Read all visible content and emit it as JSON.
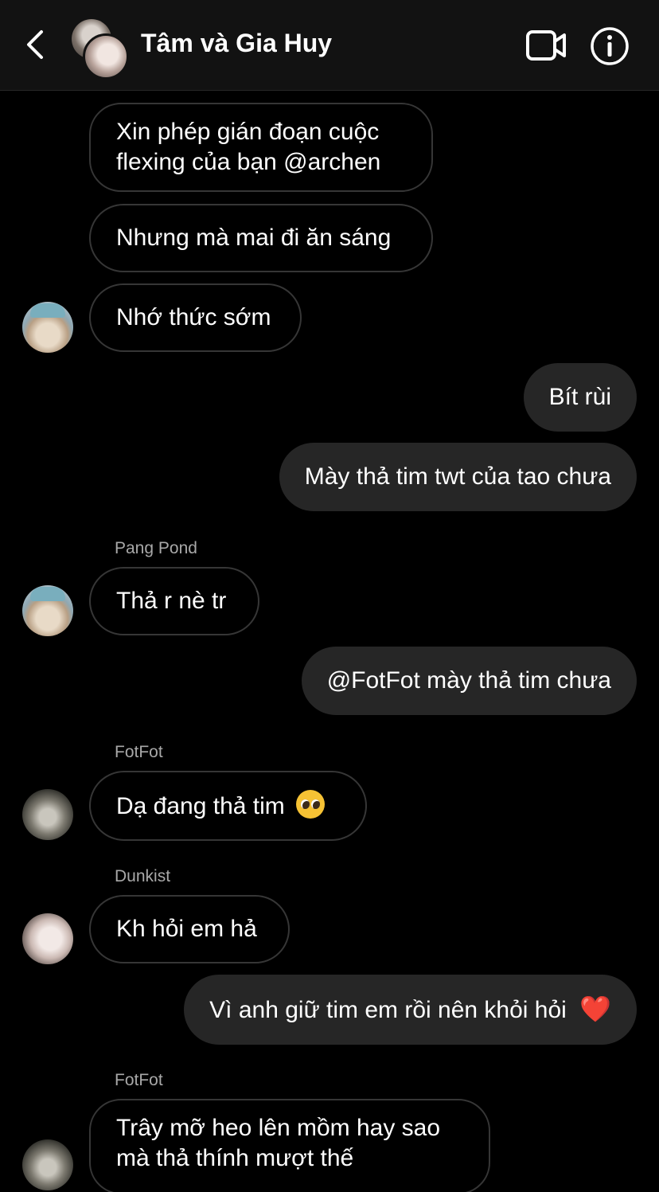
{
  "header": {
    "title": "Tâm và Gia Huy",
    "back_icon": "chevron-left-icon",
    "video_icon": "video-camera-icon",
    "info_icon": "info-icon"
  },
  "messages": [
    {
      "direction": "in",
      "text_line1": "Xin phép gián đoạn cuộc",
      "text_line2": "flexing của bạn @archen"
    },
    {
      "direction": "in",
      "text": "Nhưng mà mai đi ăn sáng"
    },
    {
      "direction": "in",
      "text": "Nhớ thức sớm"
    },
    {
      "direction": "out",
      "text": "Bít rùi"
    },
    {
      "direction": "out",
      "text": "Mày thả tim twt của tao chưa"
    },
    {
      "direction": "in",
      "sender": "Pang Pond",
      "text": "Thả r nè tr"
    },
    {
      "direction": "out",
      "text": "@FotFot mày thả tim chưa"
    },
    {
      "direction": "in",
      "sender": "FotFot",
      "text": "Dạ đang thả tim",
      "emoji": "pleading-face-emoji"
    },
    {
      "direction": "in",
      "sender": "Dunkist",
      "text": "Kh hỏi em hả"
    },
    {
      "direction": "out",
      "text": "Vì anh giữ tim em rồi nên khỏi hỏi",
      "emoji": "❤️"
    },
    {
      "direction": "in",
      "sender": "FotFot",
      "text_line1": "Trây mỡ heo lên mồm hay sao",
      "text_line2": "mà thả thính mượt thế"
    }
  ],
  "colors": {
    "background": "#000000",
    "header_bg": "#121212",
    "outgoing_bubble": "#262626",
    "incoming_border": "#363636",
    "sender_name": "#a8a8a8"
  }
}
